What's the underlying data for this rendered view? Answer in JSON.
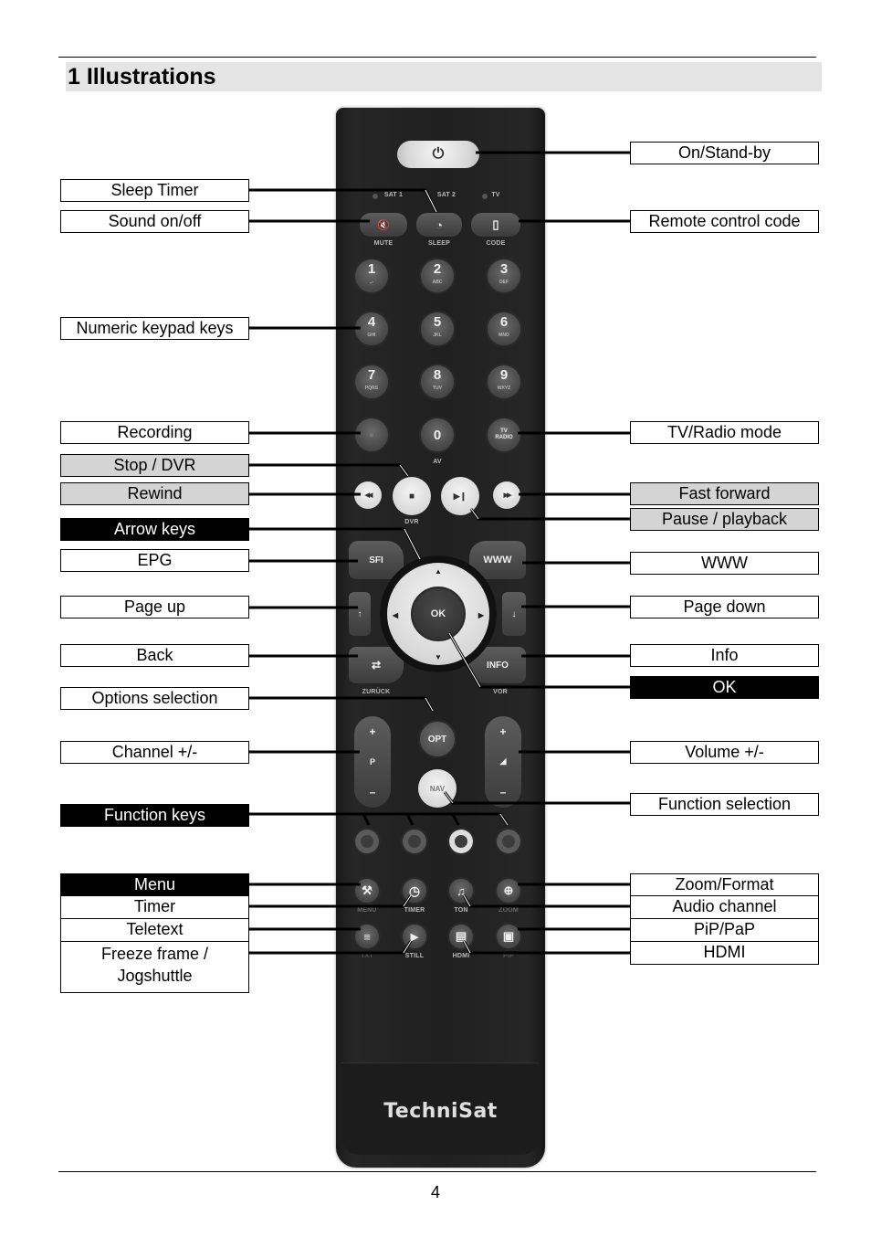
{
  "section": {
    "number": "1",
    "title": "1 Illustrations"
  },
  "page_number": "4",
  "labels_left": {
    "sleep_timer": "Sleep Timer",
    "sound": "Sound on/off",
    "numeric": "Numeric keypad keys",
    "recording": "Recording",
    "stop_dvr": "Stop / DVR",
    "rewind": "Rewind",
    "arrow_keys": "Arrow keys",
    "epg": "EPG",
    "page_up": "Page up",
    "back": "Back",
    "options": "Options selection",
    "channel": "Channel +/-",
    "function_keys": "Function keys",
    "menu": "Menu",
    "timer": "Timer",
    "teletext": "Teletext",
    "freeze": "Freeze frame / Jogshuttle"
  },
  "labels_right": {
    "on_standby": "On/Stand-by",
    "remote_code": "Remote control code",
    "tv_radio": "TV/Radio mode",
    "fast_forward": "Fast forward",
    "pause": "Pause / playback",
    "www": "WWW",
    "page_down": "Page down",
    "info": "Info",
    "ok": "OK",
    "volume": "Volume +/-",
    "function_selection": "Function selection",
    "zoom": "Zoom/Format",
    "audio": "Audio channel",
    "pip": "PiP/PaP",
    "hdmi": "HDMI"
  },
  "remote": {
    "brand": "TechniSat",
    "power_icon": "⏻",
    "leds": [
      "SAT 1",
      "SAT 2",
      "TV"
    ],
    "top_keys": [
      {
        "icon": "🔇",
        "caption": "MUTE"
      },
      {
        "icon": "◔",
        "caption": "SLEEP"
      },
      {
        "icon": "▯",
        "caption": "CODE"
      }
    ],
    "numbers": [
      {
        "digit": "1",
        "sub": ".,-"
      },
      {
        "digit": "2",
        "sub": "ABC"
      },
      {
        "digit": "3",
        "sub": "DEF"
      },
      {
        "digit": "4",
        "sub": "GHI"
      },
      {
        "digit": "5",
        "sub": "JKL"
      },
      {
        "digit": "6",
        "sub": "MNO"
      },
      {
        "digit": "7",
        "sub": "PQRS"
      },
      {
        "digit": "8",
        "sub": "TUV"
      },
      {
        "digit": "9",
        "sub": "WXYZ"
      }
    ],
    "zero": "0",
    "zero_caption": "AV",
    "tv_radio": "TV RADIO",
    "rec_icon": "●",
    "transport": {
      "rewind": "◀◀",
      "stop": "■",
      "play_pause": "▶❙",
      "ffwd": "▶▶",
      "dvr_caption": "DVR"
    },
    "sfi": "SFI",
    "www": "WWW",
    "page_up_icon": "↑",
    "page_down_icon": "↓",
    "ok": "OK",
    "arrows": {
      "up": "▲",
      "down": "▼",
      "left": "◀",
      "right": "▶"
    },
    "back_icon": "⇄",
    "back_caption": "ZURÜCK",
    "info": "INFO",
    "vor_caption": "VOR",
    "opt": "OPT",
    "nav": "NAV",
    "channel": {
      "plus": "+",
      "p": "P",
      "minus": "–"
    },
    "volume": {
      "plus": "+",
      "icon": "◢",
      "minus": "–"
    },
    "bottom_row1": [
      {
        "icon": "⚒",
        "caption": "MENU"
      },
      {
        "icon": "◷",
        "caption": "TIMER"
      },
      {
        "icon": "♫",
        "caption": "TON"
      },
      {
        "icon": "⊕",
        "caption": "ZOOM"
      }
    ],
    "bottom_row2": [
      {
        "icon": "≡",
        "caption": "TXT"
      },
      {
        "icon": "▶",
        "caption": "STILL"
      },
      {
        "icon": "▤",
        "caption": "HDMI"
      },
      {
        "icon": "▣",
        "caption": "PIP"
      }
    ]
  }
}
